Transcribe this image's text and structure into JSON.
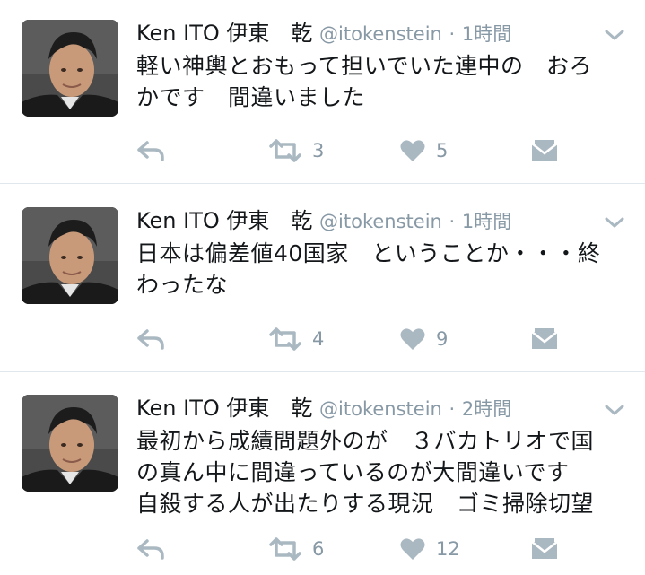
{
  "tweets": [
    {
      "name": "Ken ITO 伊東　乾",
      "handle": "@itokenstein",
      "separator": "·",
      "time": "1時間",
      "text": "軽い神輿とおもって担いでいた連中の　おろ\nかです　間違いました",
      "retweets": "3",
      "likes": "5",
      "icons": {
        "reply": "reply-icon",
        "retweet": "retweet-icon",
        "like": "heart-icon",
        "dm": "envelope-icon",
        "menu": "chevron-down-icon"
      }
    },
    {
      "name": "Ken ITO 伊東　乾",
      "handle": "@itokenstein",
      "separator": "·",
      "time": "1時間",
      "text": "日本は偏差値40国家　ということか・・・終\nわったな",
      "retweets": "4",
      "likes": "9",
      "icons": {
        "reply": "reply-icon",
        "retweet": "retweet-icon",
        "like": "heart-icon",
        "dm": "envelope-icon",
        "menu": "chevron-down-icon"
      }
    },
    {
      "name": "Ken ITO 伊東　乾",
      "handle": "@itokenstein",
      "separator": "·",
      "time": "2時間",
      "text": "最初から成績問題外のが　３バカトリオで国\nの真ん中に間違っているのが大間違いです\n自殺する人が出たりする現況　ゴミ掃除切望",
      "retweets": "6",
      "likes": "12",
      "icons": {
        "reply": "reply-icon",
        "retweet": "retweet-icon",
        "like": "heart-icon",
        "dm": "envelope-icon",
        "menu": "chevron-down-icon"
      }
    }
  ],
  "colors": {
    "text": "#14171a",
    "muted": "#8899a6",
    "icon": "#aab8c2",
    "divider": "#e1e8ed"
  }
}
